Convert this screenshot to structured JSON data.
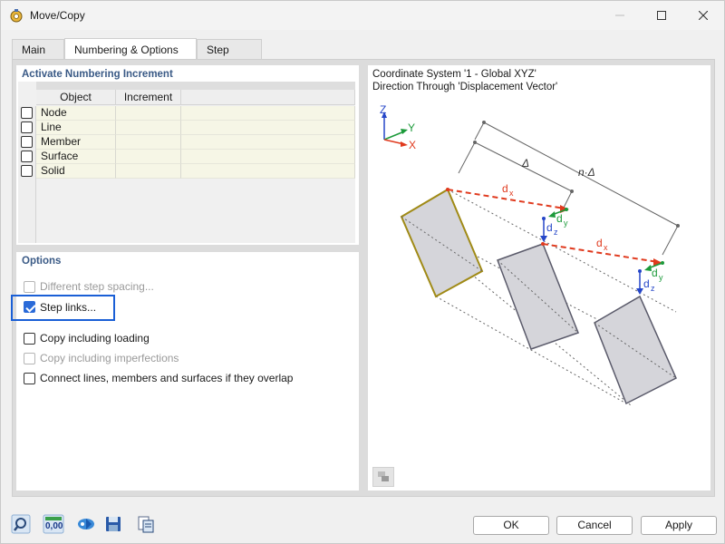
{
  "window": {
    "title": "Move/Copy"
  },
  "tabs": [
    {
      "label": "Main"
    },
    {
      "label": "Numbering & Options"
    },
    {
      "label": "Step Links"
    }
  ],
  "numbering": {
    "title": "Activate Numbering Increment",
    "columns": [
      "Object",
      "Increment"
    ],
    "rows": [
      {
        "object": "Node",
        "increment": "",
        "checked": false
      },
      {
        "object": "Line",
        "increment": "",
        "checked": false
      },
      {
        "object": "Member",
        "increment": "",
        "checked": false
      },
      {
        "object": "Surface",
        "increment": "",
        "checked": false
      },
      {
        "object": "Solid",
        "increment": "",
        "checked": false
      }
    ]
  },
  "options": {
    "title": "Options",
    "items": [
      {
        "label": "Different step spacing...",
        "checked": false,
        "enabled": false
      },
      {
        "label": "Step links...",
        "checked": true,
        "enabled": true
      },
      {
        "label": "Copy including loading",
        "checked": false,
        "enabled": true
      },
      {
        "label": "Copy including imperfections",
        "checked": false,
        "enabled": false
      },
      {
        "label": "Connect lines, members and surfaces if they overlap",
        "checked": false,
        "enabled": true
      }
    ]
  },
  "diagram": {
    "line1": "Coordinate System '1 - Global XYZ'",
    "line2": "Direction Through 'Displacement Vector'",
    "axis_z": "Z",
    "axis_y": "Y",
    "axis_x": "X",
    "delta": "Δ",
    "n_delta": "n·Δ",
    "dx": "d",
    "dx_sub": "x",
    "dy": "d",
    "dy_sub": "y",
    "dz": "d",
    "dz_sub": "z",
    "colors": {
      "dx": "#e03a1e",
      "dy": "#1c9a3a",
      "dz": "#2546c8",
      "axis_x": "#e03a1e",
      "axis_y": "#1c9a3a",
      "axis_z": "#2546c8",
      "selected_shape_border": "#a08a16"
    }
  },
  "footer": {
    "ok": "OK",
    "cancel": "Cancel",
    "apply": "Apply",
    "value_icon_text": "0,00"
  },
  "colors": {
    "accent": "#1a5fd6",
    "section_title": "#3a5a86"
  }
}
